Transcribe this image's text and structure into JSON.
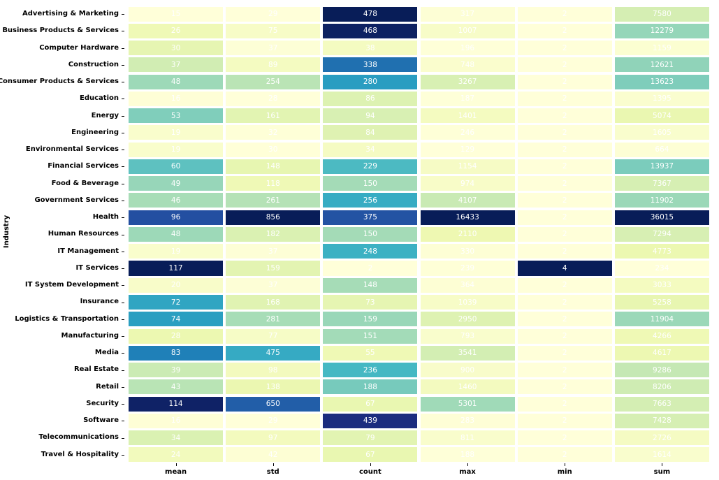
{
  "figure": {
    "type": "heatmap",
    "ylabel": "Industry",
    "xlabel": "",
    "title": ""
  },
  "chart_data": {
    "type": "heatmap",
    "title": "",
    "xlabel": "",
    "ylabel": "Industry",
    "colormap": "YlGnBu",
    "normalization": "per-column",
    "grid": false,
    "legend": "none",
    "annotated": true,
    "columns": [
      "mean",
      "std",
      "count",
      "max",
      "min",
      "sum"
    ],
    "rows": [
      "Advertising & Marketing",
      "Business Products & Services",
      "Computer Hardware",
      "Construction",
      "Consumer Products & Services",
      "Education",
      "Energy",
      "Engineering",
      "Environmental Services",
      "Financial Services",
      "Food & Beverage",
      "Government Services",
      "Health",
      "Human Resources",
      "IT Management",
      "IT Services",
      "IT System Development",
      "Insurance",
      "Logistics & Transportation",
      "Manufacturing",
      "Media",
      "Real Estate",
      "Retail",
      "Security",
      "Software",
      "Telecommunications",
      "Travel & Hospitality"
    ],
    "values": [
      [
        15,
        29,
        478,
        317,
        2,
        7580
      ],
      [
        26,
        75,
        468,
        1007,
        2,
        12279
      ],
      [
        30,
        37,
        38,
        196,
        2,
        1159
      ],
      [
        37,
        89,
        338,
        748,
        2,
        12621
      ],
      [
        48,
        254,
        280,
        3267,
        2,
        13623
      ],
      [
        16,
        28,
        86,
        187,
        2,
        1395
      ],
      [
        53,
        161,
        94,
        1401,
        2,
        5074
      ],
      [
        19,
        32,
        84,
        246,
        2,
        1605
      ],
      [
        19,
        30,
        34,
        129,
        2,
        664
      ],
      [
        60,
        148,
        229,
        1154,
        2,
        13937
      ],
      [
        49,
        118,
        150,
        974,
        2,
        7367
      ],
      [
        46,
        261,
        256,
        4107,
        2,
        11902
      ],
      [
        96,
        856,
        375,
        16433,
        2,
        36015
      ],
      [
        48,
        182,
        150,
        2110,
        2,
        7294
      ],
      [
        19,
        37,
        248,
        330,
        2,
        4773
      ],
      [
        117,
        159,
        2,
        239,
        4,
        234
      ],
      [
        20,
        37,
        148,
        364,
        2,
        3033
      ],
      [
        72,
        168,
        73,
        1039,
        2,
        5258
      ],
      [
        74,
        281,
        159,
        2950,
        2,
        11904
      ],
      [
        28,
        77,
        151,
        793,
        2,
        4266
      ],
      [
        83,
        475,
        55,
        3541,
        2,
        4617
      ],
      [
        39,
        98,
        236,
        900,
        2,
        9286
      ],
      [
        43,
        138,
        188,
        1460,
        2,
        8206
      ],
      [
        114,
        650,
        67,
        5301,
        2,
        7663
      ],
      [
        16,
        29,
        439,
        283,
        2,
        7428
      ],
      [
        34,
        97,
        79,
        811,
        2,
        2726
      ],
      [
        24,
        42,
        67,
        188,
        2,
        1614
      ]
    ]
  },
  "colors": {
    "text_on_cell": "#ffffff",
    "axis_text": "#000000",
    "background": "#ffffff",
    "cmap_stops": [
      "#ffffd9",
      "#edf8b1",
      "#c7e9b4",
      "#7fcdbb",
      "#41b6c4",
      "#1d91c0",
      "#225ea8",
      "#253494",
      "#081d58"
    ]
  }
}
